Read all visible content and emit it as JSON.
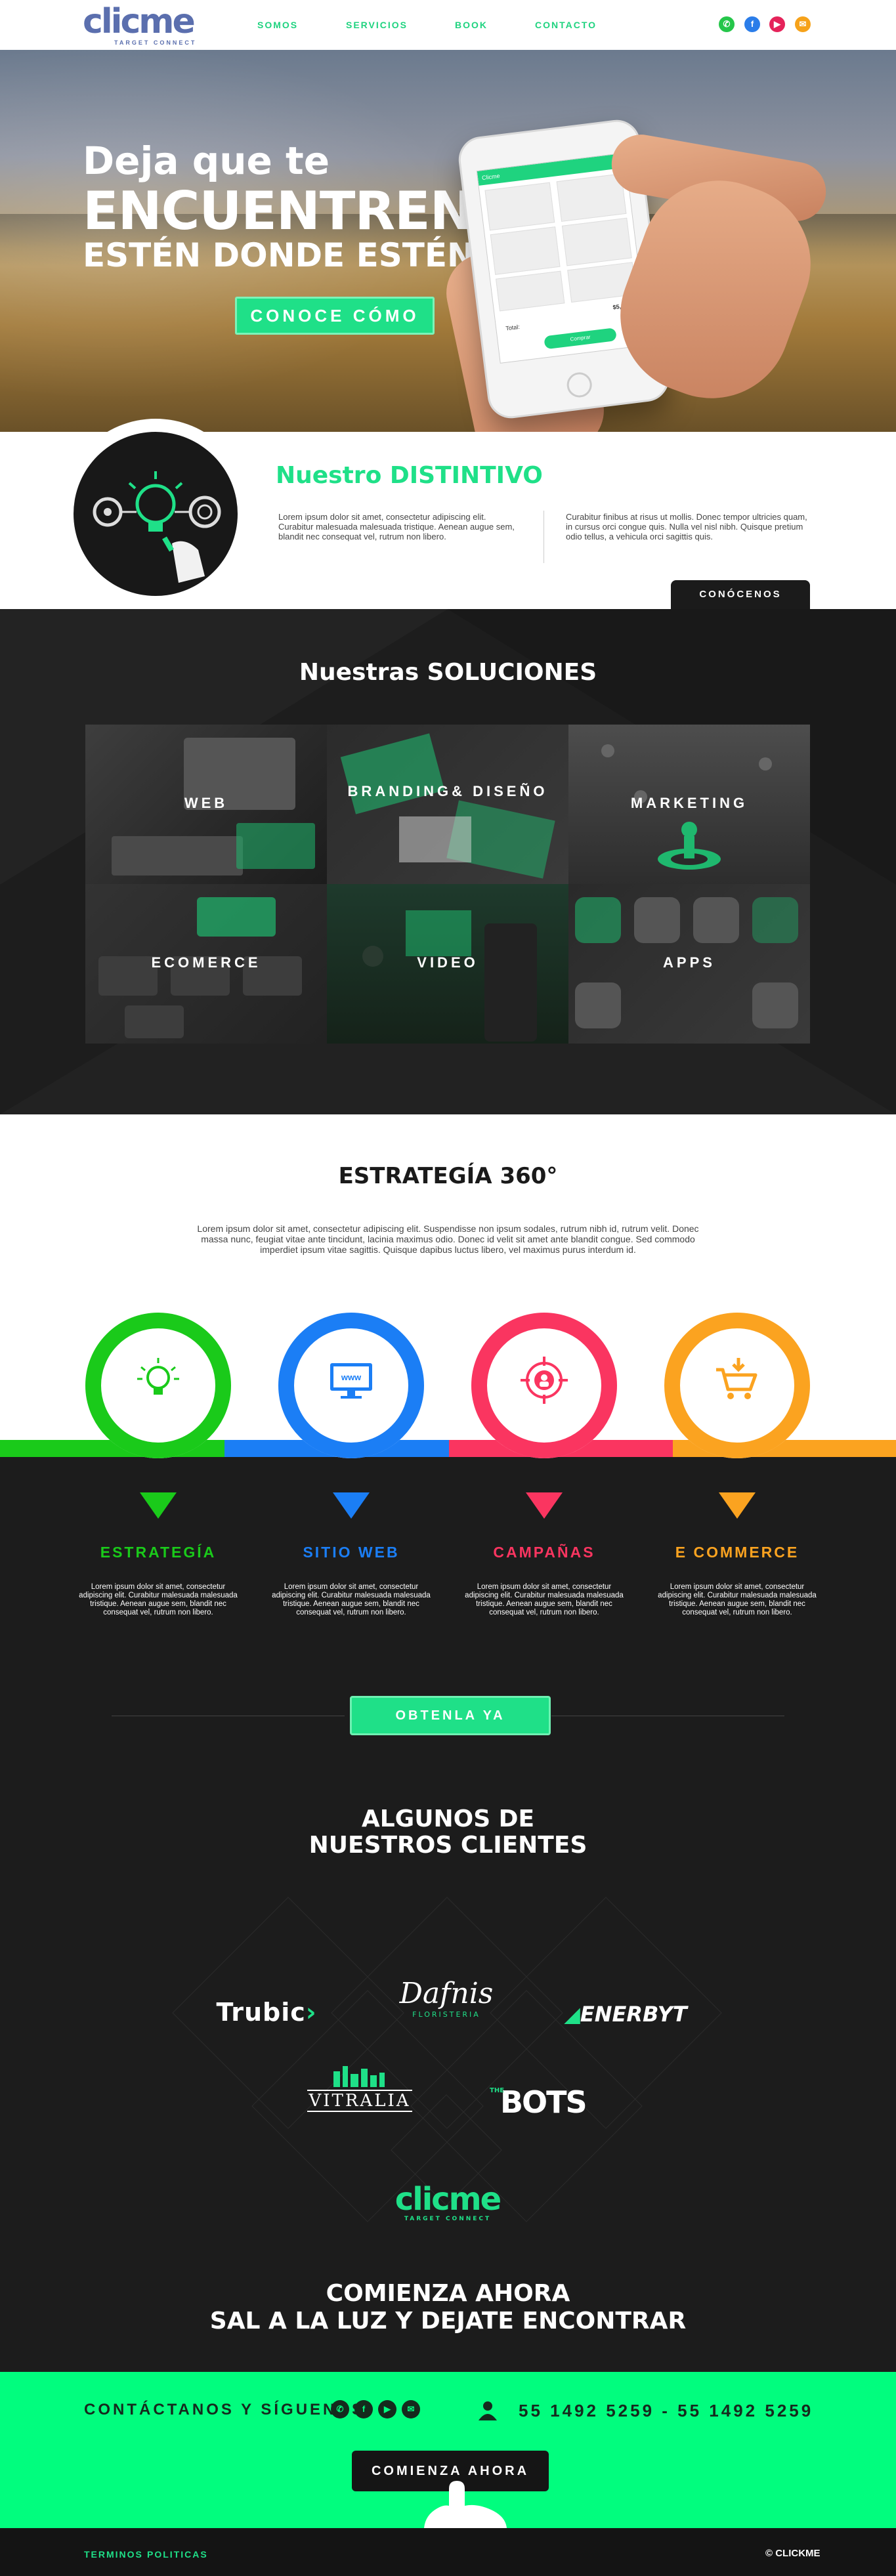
{
  "header": {
    "logo": "clicme",
    "logo_tag": "TARGET CONNECT",
    "nav": [
      "SOMOS",
      "SERVICIOS",
      "BOOK",
      "CONTACTO"
    ],
    "social_icons": [
      "whatsapp-icon",
      "facebook-icon",
      "youtube-icon",
      "email-icon"
    ]
  },
  "hero": {
    "line1": "Deja que te",
    "line2": "ENCUENTREN",
    "line3": "ESTÉN DONDE ESTÉN",
    "cta": "CONOCE CÓMO",
    "phone": {
      "app_bar": "Clicme",
      "total_label": "Total:",
      "total_value": "$5,386",
      "buy": "Comprar"
    }
  },
  "distintivo": {
    "title": "Nuestro DISTINTIVO",
    "p1": "Lorem ipsum dolor sit amet, consectetur adipiscing elit. Curabitur malesuada malesuada tristique. Aenean augue sem, blandit nec consequat vel, rutrum non libero.",
    "p2": "Curabitur finibus at risus ut mollis. Donec tempor ultricies quam, in cursus orci congue quis. Nulla vel nisl nibh. Quisque pretium odio tellus, a vehicula orci sagittis quis.",
    "button": "CONÓCENOS"
  },
  "soluciones": {
    "title": "Nuestras SOLUCIONES",
    "tiles": [
      {
        "label": "WEB"
      },
      {
        "label": "BRANDING& DISEÑO"
      },
      {
        "label": "MARKETING"
      },
      {
        "label": "ECOMERCE"
      },
      {
        "label": "VIDEO"
      },
      {
        "label": "APPS"
      }
    ]
  },
  "estrategia": {
    "title": "ESTRATEGÍA 360°",
    "text": "Lorem ipsum dolor sit amet, consectetur adipiscing elit. Suspendisse non ipsum sodales, rutrum nibh id, rutrum velit. Donec massa nunc, feugiat vitae ante tincidunt, lacinia maximus odio. Donec id velit sit amet ante blandit congue. Sed commodo imperdiet ipsum vitae sagittis. Quisque dapibus luctus libero, vel maximus purus interdum id.",
    "colors": [
      "#1aca1a",
      "#1b7ef5",
      "#fa3560",
      "#fba320"
    ],
    "items": [
      {
        "title": "ESTRATEGÍA",
        "icon": "lightbulb-icon",
        "text": "Lorem ipsum dolor sit amet, consectetur adipiscing elit. Curabitur malesuada malesuada tristique. Aenean augue sem, blandit nec consequat vel, rutrum non libero."
      },
      {
        "title": "SITIO WEB",
        "icon": "www-monitor-icon",
        "text": "Lorem ipsum dolor sit amet, consectetur adipiscing elit. Curabitur malesuada malesuada tristique. Aenean augue sem, blandit nec consequat vel, rutrum non libero."
      },
      {
        "title": "CAMPAÑAS",
        "icon": "target-audience-icon",
        "text": "Lorem ipsum dolor sit amet, consectetur adipiscing elit. Curabitur malesuada malesuada tristique. Aenean augue sem, blandit nec consequat vel, rutrum non libero."
      },
      {
        "title": "E COMMERCE",
        "icon": "shopping-cart-icon",
        "text": "Lorem ipsum dolor sit amet, consectetur adipiscing elit. Curabitur malesuada malesuada tristique. Aenean augue sem, blandit nec consequat vel, rutrum non libero."
      }
    ],
    "cta": "OBTENLA YA"
  },
  "clientes": {
    "title_line1": "ALGUNOS DE",
    "title_line2": "NUESTROS CLIENTES",
    "logos": {
      "trubic": "Trubic",
      "dafnis": "Dafnis",
      "dafnis_sub": "FLORISTERIA",
      "enerbyt": "ENERBYT",
      "vitralia": "VITRALIA",
      "bots_the": "THE",
      "bots": "BOTS"
    },
    "own_logo": "clicme",
    "own_tag": "TARGET CONNECT"
  },
  "final": {
    "line1": "COMIENZA AHORA",
    "line2": "SAL A LA LUZ Y DEJATE ENCONTRAR"
  },
  "contact": {
    "label": "CONTÁCTANOS Y SÍGUENOS",
    "phones": "55 1492 5259  -  55 1492 5259",
    "button": "COMIENZA AHORA"
  },
  "footer": {
    "links": [
      "TERMINOS",
      "POLITICAS"
    ],
    "copyright": "© CLICKME"
  }
}
